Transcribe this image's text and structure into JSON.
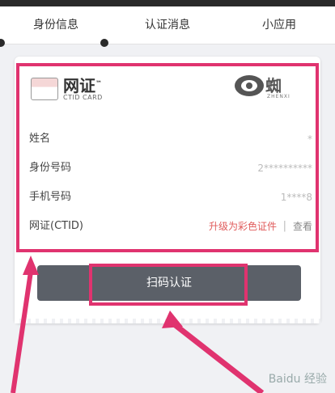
{
  "tabs": [
    {
      "label": "身份信息",
      "active": true
    },
    {
      "label": "认证消息",
      "active": false
    },
    {
      "label": "小应用",
      "active": false
    }
  ],
  "card": {
    "logo": {
      "title": "网证",
      "subtitle": "CTID CARD",
      "superscript": "™"
    },
    "brand": {
      "name": "蜘",
      "sub": "ZHENXI"
    },
    "rows": [
      {
        "label": "姓名",
        "value": "*"
      },
      {
        "label": "身份号码",
        "value": "2**********"
      },
      {
        "label": "手机号码",
        "value": "1****8"
      },
      {
        "label": "网证(CTID)",
        "upgrade": "升级为彩色证件",
        "view": "查看"
      }
    ]
  },
  "scan_button": {
    "label": "扫码认证"
  },
  "colors": {
    "highlight": "#e0336f",
    "button": "#5b6068",
    "accent_red": "#e05b5b"
  },
  "watermark": "Baidu 经验"
}
